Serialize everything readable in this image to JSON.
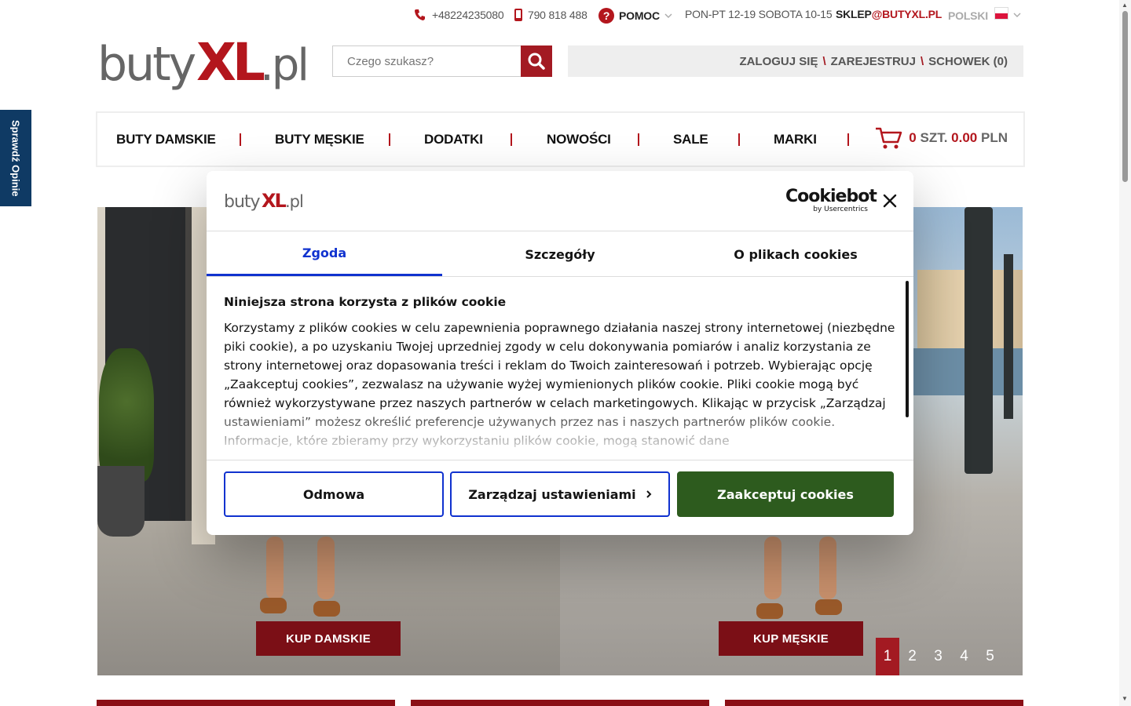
{
  "topbar": {
    "phone": "+48224235080",
    "mobile": "790 818 488",
    "help": "POMOC",
    "hours": "PON-PT 12-19 SOBOTA 10-15",
    "email_prefix": "SKLEP",
    "email_domain": "@BUTYXL.PL",
    "language": "POLSKI"
  },
  "header": {
    "logo_text_a": "buty",
    "logo_text_b": "XL",
    "logo_text_c": ".pl",
    "search_placeholder": "Czego szukasz?",
    "login": "ZALOGUJ SIĘ",
    "register": "ZAREJESTRUJ",
    "wishlist": "SCHOWEK (0)",
    "account_sep": "\\"
  },
  "nav": {
    "items": [
      "BUTY DAMSKIE",
      "BUTY MĘSKIE",
      "DODATKI",
      "NOWOŚCI",
      "SALE",
      "MARKI"
    ],
    "cart_count": "0",
    "cart_unit": "SZT.",
    "cart_amount": "0.00",
    "cart_currency": "PLN"
  },
  "hero": {
    "btn_women": "KUP DAMSKIE",
    "btn_men": "KUP MĘSKIE",
    "pages": [
      "1",
      "2",
      "3",
      "4",
      "5"
    ],
    "active_page": "1"
  },
  "side_tab": "Sprawdź Opinie",
  "cookie": {
    "logo_a": "buty",
    "logo_b": "XL",
    "logo_c": ".pl",
    "brand_big": "Cookiebot",
    "brand_small": "by Usercentrics",
    "tabs": [
      "Zgoda",
      "Szczegóły",
      "O plikach cookies"
    ],
    "title": "Niniejsza strona korzysta z plików cookie",
    "text": "Korzystamy z plików cookies w celu zapewnienia poprawnego działania naszej strony internetowej (niezbędne piki cookie), a po uzyskaniu Twojej uprzedniej zgody w celu dokonywania pomiarów i analiz korzystania ze strony internetowej oraz dopasowania treści i reklam do Twoich zainteresowań i potrzeb. Wybierając opcję „Zaakceptuj cookies”, zezwalasz na używanie wyżej wymienionych plików cookie. Pliki cookie mogą być również wykorzystywane przez naszych partnerów w celach marketingowych. Klikając w przycisk „Zarządzaj ustawieniami” możesz określić preferencje używanych przez nas i naszych partnerów plików cookie. Informacje, które zbieramy przy wykorzystaniu plików cookie, mogą stanowić dane",
    "btn_deny": "Odmowa",
    "btn_manage": "Zarządzaj ustawieniami",
    "btn_accept": "Zaakceptuj cookies"
  },
  "colors": {
    "brand_red": "#a31a22",
    "cookie_blue": "#1032cf",
    "accept_green": "#2d5b1e",
    "side_tab_blue": "#0f3a64"
  }
}
